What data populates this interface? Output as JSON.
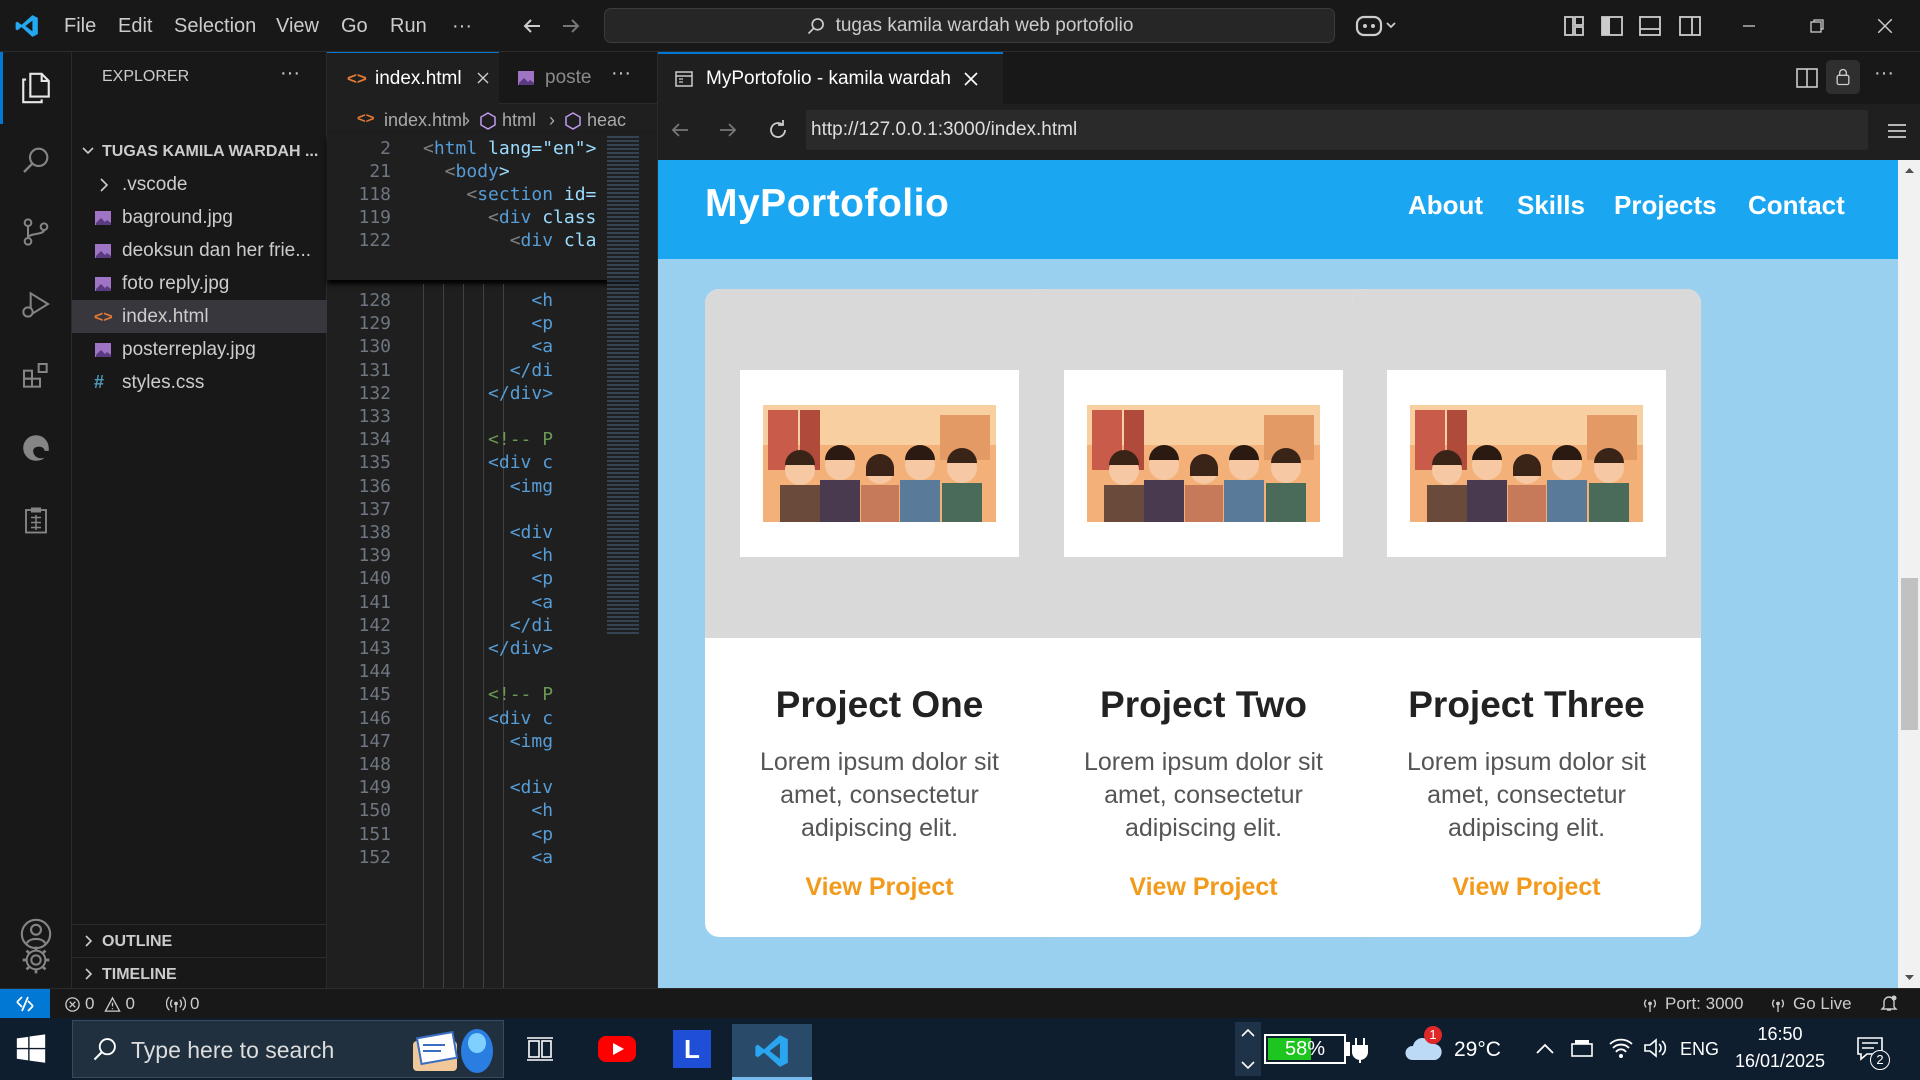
{
  "titlebar": {
    "menus": [
      "File",
      "Edit",
      "Selection",
      "View",
      "Go",
      "Run",
      "···"
    ],
    "command_center": "tugas kamila wardah web portofolio"
  },
  "sidebar": {
    "header": "EXPLORER",
    "more": "···",
    "folder": "TUGAS KAMILA WARDAH ...",
    "items": [
      {
        "label": ".vscode",
        "type": "folder"
      },
      {
        "label": "baground.jpg",
        "type": "image"
      },
      {
        "label": "deoksun dan her frie...",
        "type": "image"
      },
      {
        "label": "foto reply.jpg",
        "type": "image"
      },
      {
        "label": "index.html",
        "type": "html"
      },
      {
        "label": "posterreplay.jpg",
        "type": "image"
      },
      {
        "label": "styles.css",
        "type": "css"
      }
    ],
    "outline": "OUTLINE",
    "timeline": "TIMELINE"
  },
  "editor": {
    "tabs": [
      {
        "label": "index.html"
      },
      {
        "label": "poste"
      }
    ],
    "more": "···",
    "breadcrumb": [
      "index.html",
      "html",
      "heac"
    ],
    "sticky_lines": [
      {
        "n": "2",
        "pre": "<",
        "tag": "html",
        "rest": " lang=\"en\">"
      },
      {
        "n": "21",
        "pre": "  <",
        "tag": "body",
        "rest": ">"
      },
      {
        "n": "118",
        "pre": "    <",
        "tag": "section",
        "rest": " id="
      },
      {
        "n": "119",
        "pre": "      <",
        "tag": "div",
        "rest": " class"
      },
      {
        "n": "122",
        "pre": "        <",
        "tag": "div",
        "rest": " cla"
      }
    ],
    "lines": [
      {
        "n": "128",
        "text": "          <h"
      },
      {
        "n": "129",
        "text": "          <p"
      },
      {
        "n": "130",
        "text": "          <a"
      },
      {
        "n": "131",
        "text": "        </di"
      },
      {
        "n": "132",
        "text": "      </div>"
      },
      {
        "n": "133",
        "text": ""
      },
      {
        "n": "134",
        "text": "      <!-- P"
      },
      {
        "n": "135",
        "text": "      <div c"
      },
      {
        "n": "136",
        "text": "        <img"
      },
      {
        "n": "137",
        "text": ""
      },
      {
        "n": "138",
        "text": "        <div"
      },
      {
        "n": "139",
        "text": "          <h"
      },
      {
        "n": "140",
        "text": "          <p"
      },
      {
        "n": "141",
        "text": "          <a"
      },
      {
        "n": "142",
        "text": "        </di"
      },
      {
        "n": "143",
        "text": "      </div>"
      },
      {
        "n": "144",
        "text": ""
      },
      {
        "n": "145",
        "text": "      <!-- P"
      },
      {
        "n": "146",
        "text": "      <div c"
      },
      {
        "n": "147",
        "text": "        <img"
      },
      {
        "n": "148",
        "text": ""
      },
      {
        "n": "149",
        "text": "        <div"
      },
      {
        "n": "150",
        "text": "          <h"
      },
      {
        "n": "151",
        "text": "          <p"
      },
      {
        "n": "152",
        "text": "          <a"
      }
    ]
  },
  "browser": {
    "tab_title": "MyPortofolio - kamila wardah",
    "url": "http://127.0.0.1:3000/index.html"
  },
  "site": {
    "logo": "MyPortofolio",
    "nav": [
      "About",
      "Skills",
      "Projects",
      "Contact"
    ],
    "projects": [
      {
        "title": "Project One",
        "desc": "Lorem ipsum dolor sit amet, consectetur adipiscing elit.",
        "link": "View Project"
      },
      {
        "title": "Project Two",
        "desc": "Lorem ipsum dolor sit amet, consectetur adipiscing elit.",
        "link": "View Project"
      },
      {
        "title": "Project Three",
        "desc": "Lorem ipsum dolor sit amet, consectetur adipiscing elit.",
        "link": "View Project"
      }
    ]
  },
  "statusbar": {
    "errors": "0",
    "warnings": "0",
    "ports": "0",
    "port_label": "Port: 3000",
    "golive": "Go Live"
  },
  "taskbar": {
    "search_placeholder": "Type here to search",
    "battery": "58%",
    "weather": "29°C",
    "weather_badge": "1",
    "lang": "ENG",
    "time": "16:50",
    "date": "16/01/2025",
    "notif_count": "2",
    "app_l_letter": "L"
  },
  "colors": {
    "accent": "#0078d4",
    "site_nav": "#1aa6f0",
    "site_bg": "#99d0f0",
    "link": "#f29a1c",
    "html_icon": "#e37933",
    "image_icon": "#a074c4",
    "css_icon": "#519aba"
  }
}
